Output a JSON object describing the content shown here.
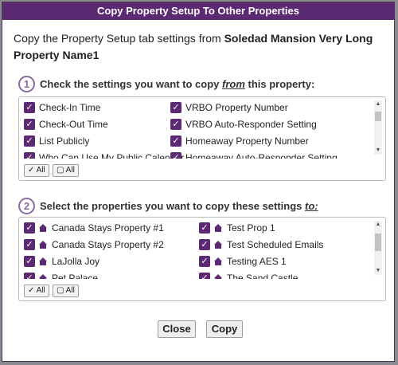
{
  "dialog": {
    "title": "Copy Property Setup To Other Properties",
    "intro_prefix": "Copy the Property Setup tab settings from ",
    "property_name": "Soledad Mansion Very Long Property Name1"
  },
  "step1": {
    "number": "1",
    "label_before": "Check the settings you want to copy ",
    "label_em": "from",
    "label_after": " this property:",
    "items": [
      "Check-In Time",
      "VRBO Property Number",
      "Check-Out Time",
      "VRBO Auto-Responder Setting",
      "List Publicly",
      "Homeaway Property Number",
      "Who Can Use My Public Calendar",
      "Homeaway Auto-Responder Setting"
    ],
    "select_all": "✓ All",
    "select_none": "▢ All"
  },
  "step2": {
    "number": "2",
    "label_before": "Select the properties you want to copy these settings ",
    "label_em": "to:",
    "items": [
      "Canada Stays Property #1",
      "Test Prop 1",
      "Canada Stays Property #2",
      "Test Scheduled Emails",
      "LaJolla Joy",
      "Testing AES 1",
      "Pet Palace",
      "The Sand Castle"
    ],
    "select_all": "✓ All",
    "select_none": "▢ All"
  },
  "buttons": {
    "close": "Close",
    "copy": "Copy"
  },
  "colors": {
    "accent": "#5b2a73",
    "step_circle": "#8a6aa2"
  },
  "icons": {
    "checkbox": "checkmark-icon",
    "property": "house-icon"
  }
}
